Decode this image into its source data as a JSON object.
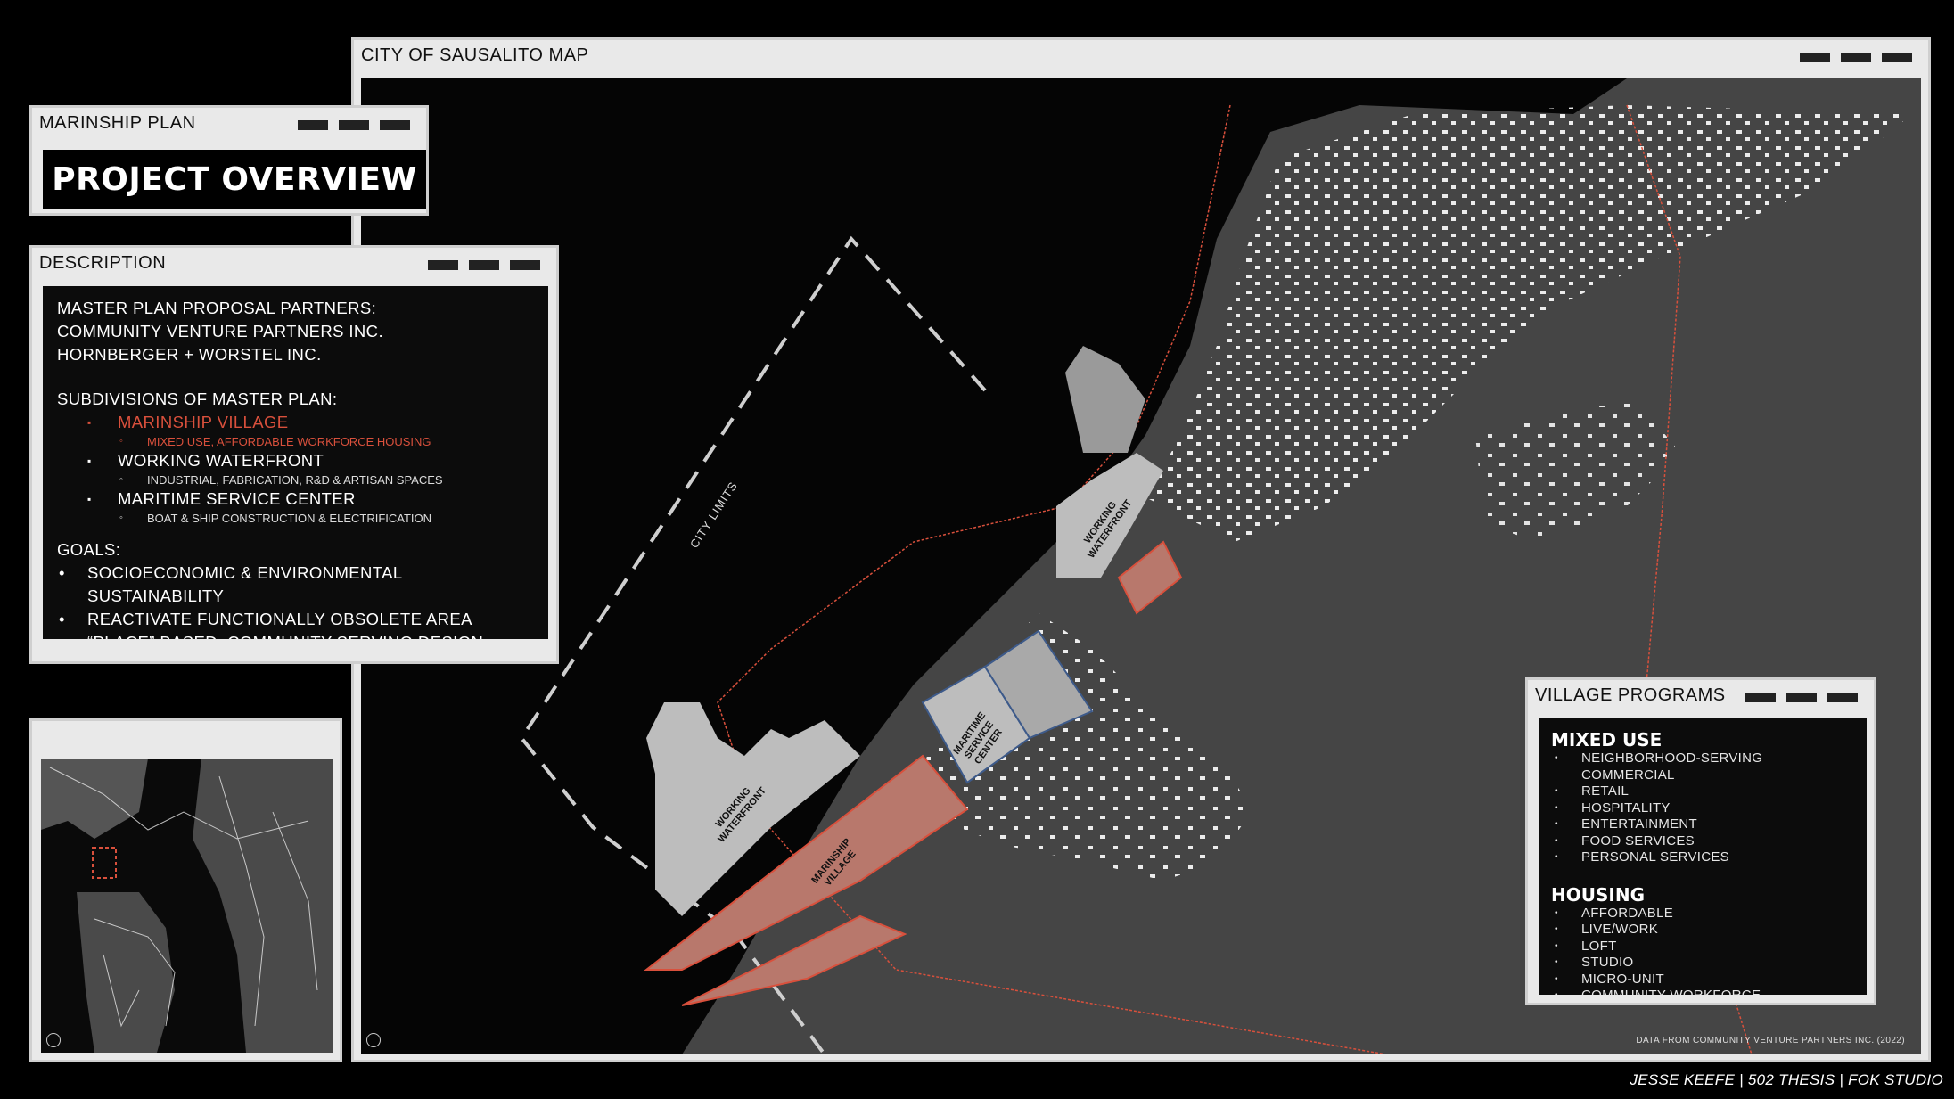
{
  "overview": {
    "window_title": "MARINSHIP PLAN",
    "headline": "PROJECT OVERVIEW"
  },
  "description": {
    "window_title": "DESCRIPTION",
    "partners_heading": "MASTER PLAN PROPOSAL PARTNERS:",
    "partners": [
      "COMMUNITY VENTURE PARTNERS INC.",
      "HORNBERGER + WORSTEL INC."
    ],
    "subdivisions_heading": "SUBDIVISIONS OF MASTER PLAN:",
    "subdivisions": [
      {
        "name": "MARINSHIP VILLAGE",
        "detail": "MIXED USE, AFFORDABLE WORKFORCE HOUSING",
        "highlight": true
      },
      {
        "name": "WORKING WATERFRONT",
        "detail": "INDUSTRIAL, FABRICATION, R&D & ARTISAN SPACES"
      },
      {
        "name": "MARITIME SERVICE CENTER",
        "detail": "BOAT & SHIP CONSTRUCTION & ELECTRIFICATION"
      }
    ],
    "goals_heading": "GOALS:",
    "goals": [
      "SOCIOECONOMIC & ENVIRONMENTAL",
      "SUSTAINABILITY",
      "REACTIVATE FUNCTIONALLY OBSOLETE AREA",
      "“PLACE”  BASED, COMMUNITY-SERVING DESIGN"
    ]
  },
  "map": {
    "window_title": "CITY OF SAUSALITO MAP",
    "city_limits_label": "CITY LIMITS",
    "zone_labels": {
      "ww_left_1": "WORKING",
      "ww_left_2": "WATERFRONT",
      "mv_1": "MARINSHIP",
      "mv_2": "VILLAGE",
      "msc_1": "MARITIME",
      "msc_2": "SERVICE",
      "msc_3": "CENTER",
      "ww_right_1": "WORKING",
      "ww_right_2": "WATERFRONT"
    },
    "data_note": "DATA FROM COMMUNITY VENTURE PARTNERS INC. (2022)"
  },
  "programs": {
    "window_title": "VILLAGE PROGRAMS",
    "mixed_use_heading": "MIXED USE",
    "mixed_use": [
      "NEIGHBORHOOD-SERVING COMMERCIAL",
      "RETAIL",
      "HOSPITALITY",
      "ENTERTAINMENT",
      "FOOD SERVICES",
      "PERSONAL SERVICES"
    ],
    "housing_heading": "HOUSING",
    "housing": [
      "AFFORDABLE",
      "LIVE/WORK",
      "LOFT",
      "STUDIO",
      "MICRO-UNIT",
      "COMMUNITY WORKFORCE"
    ]
  },
  "credit": "JESSE KEEFE | 502 THESIS | FOK STUDIO",
  "colors": {
    "accent_red": "#d9503c",
    "zone_red": "#b8786c",
    "zone_gray": "#bdbdbd",
    "land": "#454545",
    "water": "#050505"
  },
  "icons": [
    "compass-icon",
    "window-control-icon"
  ]
}
